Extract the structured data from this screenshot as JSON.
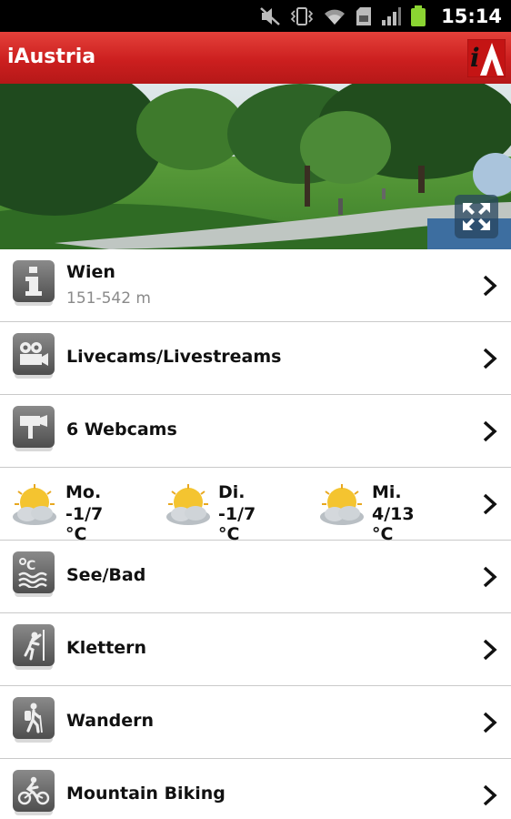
{
  "status_bar": {
    "time": "15:14",
    "icons": [
      "mute-icon",
      "vibrate-icon",
      "wifi-icon",
      "sd-card-icon",
      "signal-icon",
      "battery-icon"
    ],
    "battery_color": "#8bd432"
  },
  "app": {
    "title": "iAustria",
    "logo_text": "iA",
    "bar_color": "#d2211e"
  },
  "hero": {
    "image": "park-scene",
    "fullscreen_icon": "expand-icon"
  },
  "list": {
    "info": {
      "icon": "info-icon",
      "label": "Wien",
      "sub": "151-542 m"
    },
    "livecams": {
      "icon": "video-camera-icon",
      "label": "Livecams/Livestreams"
    },
    "webcams": {
      "icon": "webcam-icon",
      "label": "6 Webcams"
    },
    "weather": [
      {
        "icon": "partly-cloudy-icon",
        "day": "Mo.",
        "temp": "-1/7 °C"
      },
      {
        "icon": "partly-cloudy-icon",
        "day": "Di.",
        "temp": "-1/7 °C"
      },
      {
        "icon": "partly-cloudy-icon",
        "day": "Mi.",
        "temp": "4/13 °C"
      }
    ],
    "lake": {
      "icon": "water-temperature-icon",
      "label": "See/Bad"
    },
    "climbing": {
      "icon": "climbing-icon",
      "label": "Klettern"
    },
    "hiking": {
      "icon": "hiking-icon",
      "label": "Wandern"
    },
    "biking": {
      "icon": "mountain-bike-icon",
      "label": "Mountain Biking"
    }
  }
}
